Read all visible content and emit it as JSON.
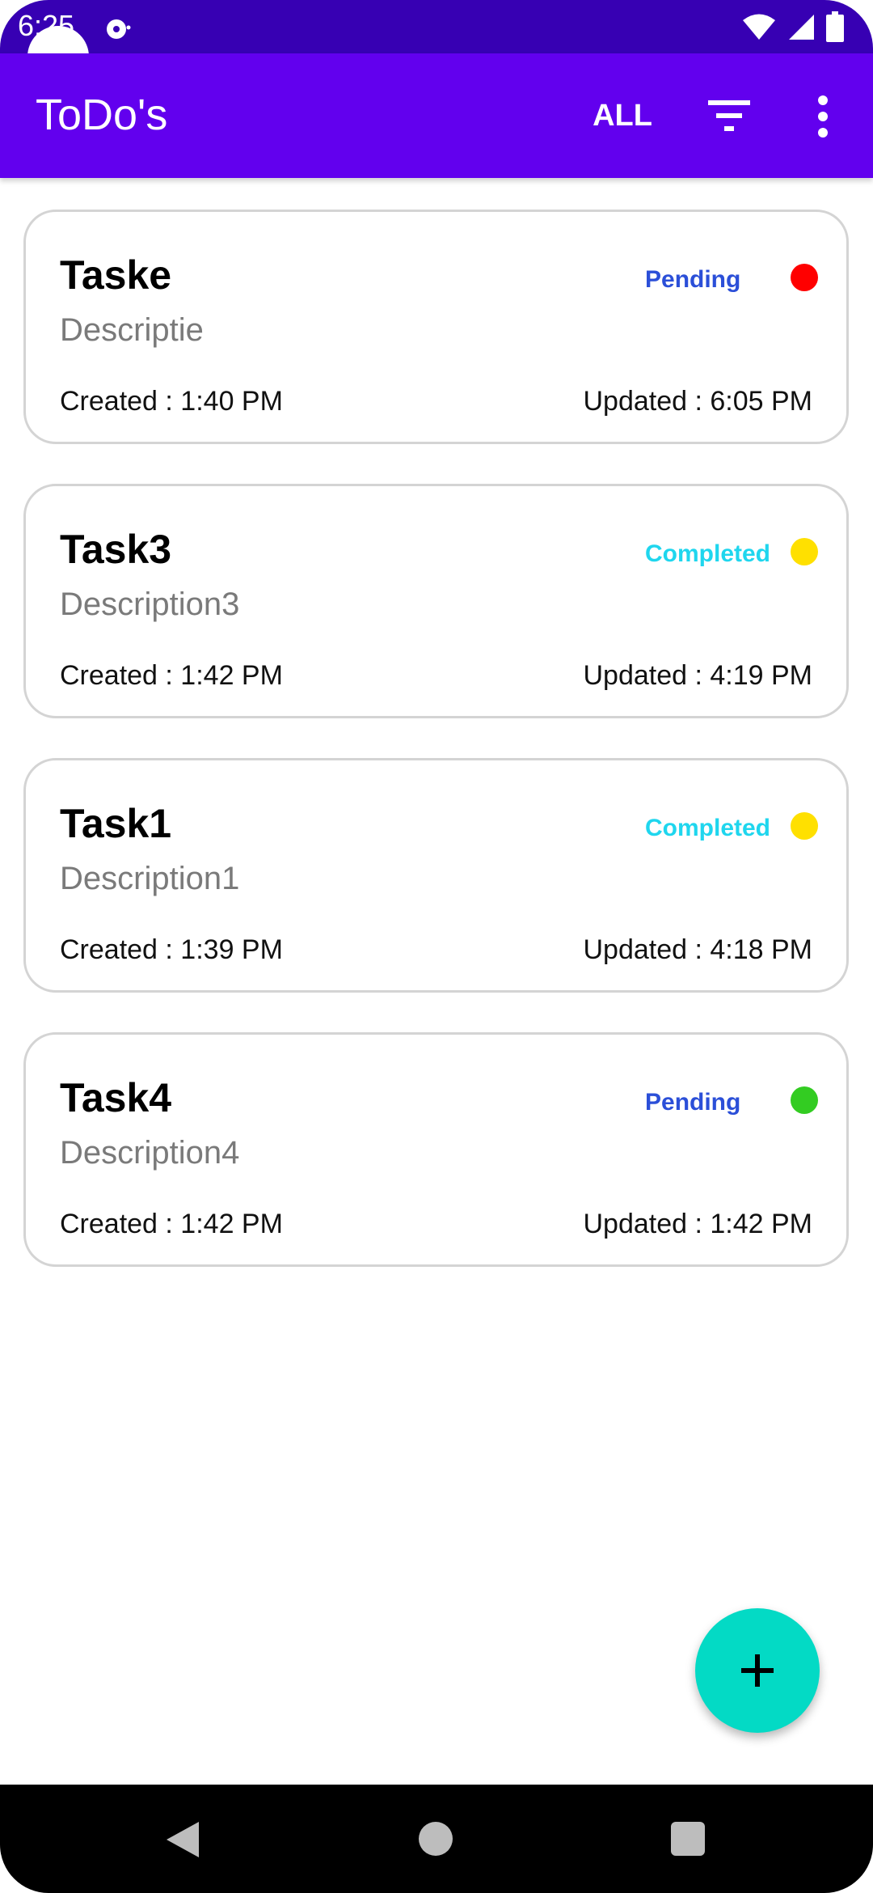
{
  "status_bar": {
    "time": "6:25",
    "notification_icon": "notification-icon",
    "icons": [
      "wifi-icon",
      "cellular-signal-icon",
      "battery-icon"
    ]
  },
  "app_bar": {
    "title": "ToDo's",
    "filter_label": "ALL",
    "filter_icon": "filter-icon",
    "overflow_icon": "more-vert-icon"
  },
  "tasks": [
    {
      "title": "Taske",
      "description": "Descriptie",
      "status": "Pending",
      "priority_color": "#ff0000",
      "created": "Created : 1:40 PM",
      "updated": "Updated : 6:05 PM"
    },
    {
      "title": "Task3",
      "description": "Description3",
      "status": "Completed",
      "priority_color": "#ffe000",
      "created": "Created : 1:42 PM",
      "updated": "Updated : 4:19 PM"
    },
    {
      "title": "Task1",
      "description": "Description1",
      "status": "Completed",
      "priority_color": "#ffe000",
      "created": "Created : 1:39 PM",
      "updated": "Updated : 4:18 PM"
    },
    {
      "title": "Task4",
      "description": "Description4",
      "status": "Pending",
      "priority_color": "#33cc22",
      "created": "Created : 1:42 PM",
      "updated": "Updated : 1:42 PM"
    }
  ],
  "fab": {
    "icon": "plus-icon"
  },
  "nav_bar": {
    "icons": [
      "back-icon",
      "home-icon",
      "recents-icon"
    ]
  },
  "colors": {
    "status_bar": "#3700b3",
    "app_bar": "#6200ee",
    "fab": "#03dac5",
    "pending_text": "#2b4fd8",
    "completed_text": "#1fd6ee"
  }
}
